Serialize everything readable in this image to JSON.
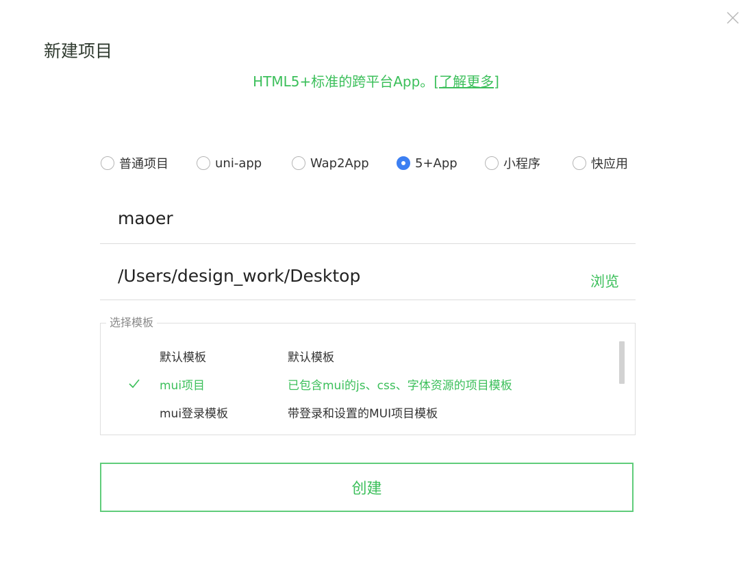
{
  "dialog": {
    "title": "新建项目",
    "subtitle_text": "HTML5+标准的跨平台App。",
    "subtitle_link": "[了解更多]",
    "close_icon": "close-icon"
  },
  "project_types": [
    {
      "label": "普通项目",
      "checked": false
    },
    {
      "label": "uni-app",
      "checked": false
    },
    {
      "label": "Wap2App",
      "checked": false
    },
    {
      "label": "5+App",
      "checked": true
    },
    {
      "label": "小程序",
      "checked": false
    },
    {
      "label": "快应用",
      "checked": false
    }
  ],
  "form": {
    "project_name": "maoer",
    "project_path": "/Users/design_work/Desktop",
    "browse_label": "浏览"
  },
  "templates": {
    "legend": "选择模板",
    "items": [
      {
        "name": "默认模板",
        "description": "默认模板",
        "selected": false
      },
      {
        "name": "mui项目",
        "description": "已包含mui的js、css、字体资源的项目模板",
        "selected": true
      },
      {
        "name": "mui登录模板",
        "description": "带登录和设置的MUI项目模板",
        "selected": false
      }
    ]
  },
  "actions": {
    "create_label": "创建"
  },
  "colors": {
    "accent_green": "#3bbf5a",
    "radio_checked_blue": "#3c7ff2",
    "title_text": "#2f3a2f"
  }
}
